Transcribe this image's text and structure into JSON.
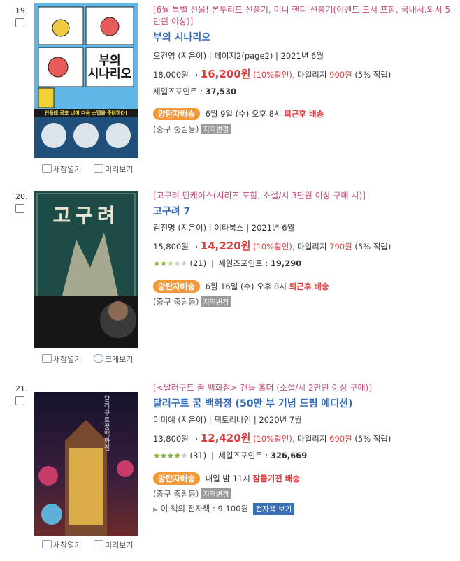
{
  "items": [
    {
      "rank": "19.",
      "promo": "[6월 특별 선물! 본투리드 선풍기, 미니 핸디 선풍기(이벤트 도서 포함, 국내서.외서 5만원 이상)]",
      "title": "부의 시나리오",
      "meta": "오건영 (지은이) | 페이지2(page2) | 2021년 6월",
      "list_price": "18,000원",
      "arrow": "→",
      "sale_price": "16,200원",
      "discount": "(10%할인),",
      "mileage_pre": "마일리지",
      "mileage": "900원",
      "mileage_rate": "(5% 적립)",
      "sales_point_label": "세일즈포인트 :",
      "sales_point": "37,530",
      "ship_badge": "양탄자배송",
      "ship_text": "6월 9일 (수) 오후 8시",
      "ship_highlight": "퇴근후 배송",
      "area": "(중구 중림동)",
      "area_tag": "지역변경",
      "link1": "새창열기",
      "link2": "미리보기",
      "cover_title": "부의\n시나리오",
      "cover_banner": "인플레 공포 너머 다음 스텝을 준비하라!"
    },
    {
      "rank": "20.",
      "promo": "[고구려 틴케이스(시리즈 포함, 소설/시 3만원 이상 구매 시)]",
      "title": "고구려 7",
      "meta": "김진명 (지은이) | 이타북스 | 2021년 6월",
      "list_price": "15,800원",
      "arrow": "→",
      "sale_price": "14,220원",
      "discount": "(10%할인),",
      "mileage_pre": "마일리지",
      "mileage": "790원",
      "mileage_rate": "(5% 적립)",
      "rating": 2.5,
      "review_count": "(21)",
      "sales_point_label": "세일즈포인트 :",
      "sales_point": "19,290",
      "ship_badge": "양탄자배송",
      "ship_text": "6월 16일 (수) 오후 8시",
      "ship_highlight": "퇴근후 배송",
      "area": "(중구 중림동)",
      "area_tag": "지역변경",
      "link1": "새창열기",
      "link2": "크게보기",
      "cover_title": "고구려"
    },
    {
      "rank": "21.",
      "promo": "[<달러구트 꿈 백화점> 캔들 홀더 (소설/시 2만원 이상 구매)]",
      "title": "달러구트 꿈 백화점 (50만 부 기념 드림 에디션)",
      "meta": "이미예 (지은이) | 팩토리나인 | 2020년 7월",
      "list_price": "13,800원",
      "arrow": "→",
      "sale_price": "12,420원",
      "discount": "(10%할인),",
      "mileage_pre": "마일리지",
      "mileage": "690원",
      "mileage_rate": "(5% 적립)",
      "rating": 4,
      "review_count": "(31)",
      "sales_point_label": "세일즈포인트 :",
      "sales_point": "326,669",
      "ship_badge": "양탄자배송",
      "ship_text": "내일 밤 11시",
      "ship_highlight": "잠들기전 배송",
      "area": "(중구 중림동)",
      "area_tag": "지역변경",
      "ebook_text": "이 책의 전자책 : 9,100원",
      "ebook_button": "전자책 보기",
      "link1": "새창열기",
      "link2": "미리보기",
      "cover_title": "달러구트 꿈 백화점"
    }
  ]
}
